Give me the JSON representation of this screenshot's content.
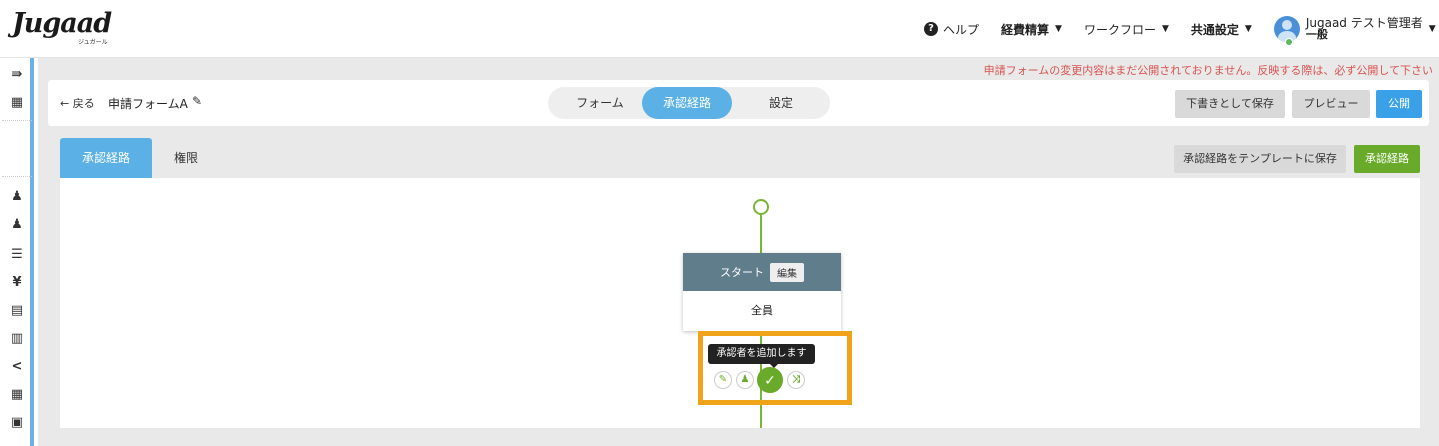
{
  "header": {
    "logo_text": "Jugaad",
    "logo_sub": "ジュガール",
    "help_label": "ヘルプ",
    "nav": [
      {
        "label": "経費精算"
      },
      {
        "label": "ワークフロー"
      },
      {
        "label": "共通設定"
      }
    ],
    "user_name": "Jugaad テスト管理者",
    "user_role": "一般"
  },
  "rail": {
    "icons": [
      "menu-expand-icon",
      "building-icon",
      "users-icon",
      "users-icon",
      "list-icon",
      "yen-icon",
      "document-icon",
      "receipt-icon",
      "share-icon",
      "grid-icon",
      "book-icon"
    ]
  },
  "warning_text": "申請フォームの変更内容はまだ公開されておりません。反映する際は、必ず公開して下さい",
  "toolbar": {
    "back_label": "← 戻る",
    "form_name": "申請フォームA",
    "segments": [
      "フォーム",
      "承認経路",
      "設定"
    ],
    "save_draft_label": "下書きとして保存",
    "preview_label": "プレビュー",
    "publish_label": "公開"
  },
  "tabs": {
    "items": [
      "承認経路",
      "権限"
    ],
    "save_template_label": "承認経路をテンプレートに保存",
    "route_label": "承認経路"
  },
  "flow": {
    "node_title": "スタート",
    "node_edit_label": "編集",
    "node_body": "全員",
    "tooltip": "承認者を追加します"
  },
  "colors": {
    "accent_blue": "#5bb1e6",
    "accent_green": "#6aaa2a",
    "node_header": "#607d8b",
    "highlight": "#f0a318",
    "warning": "#d9534f"
  }
}
